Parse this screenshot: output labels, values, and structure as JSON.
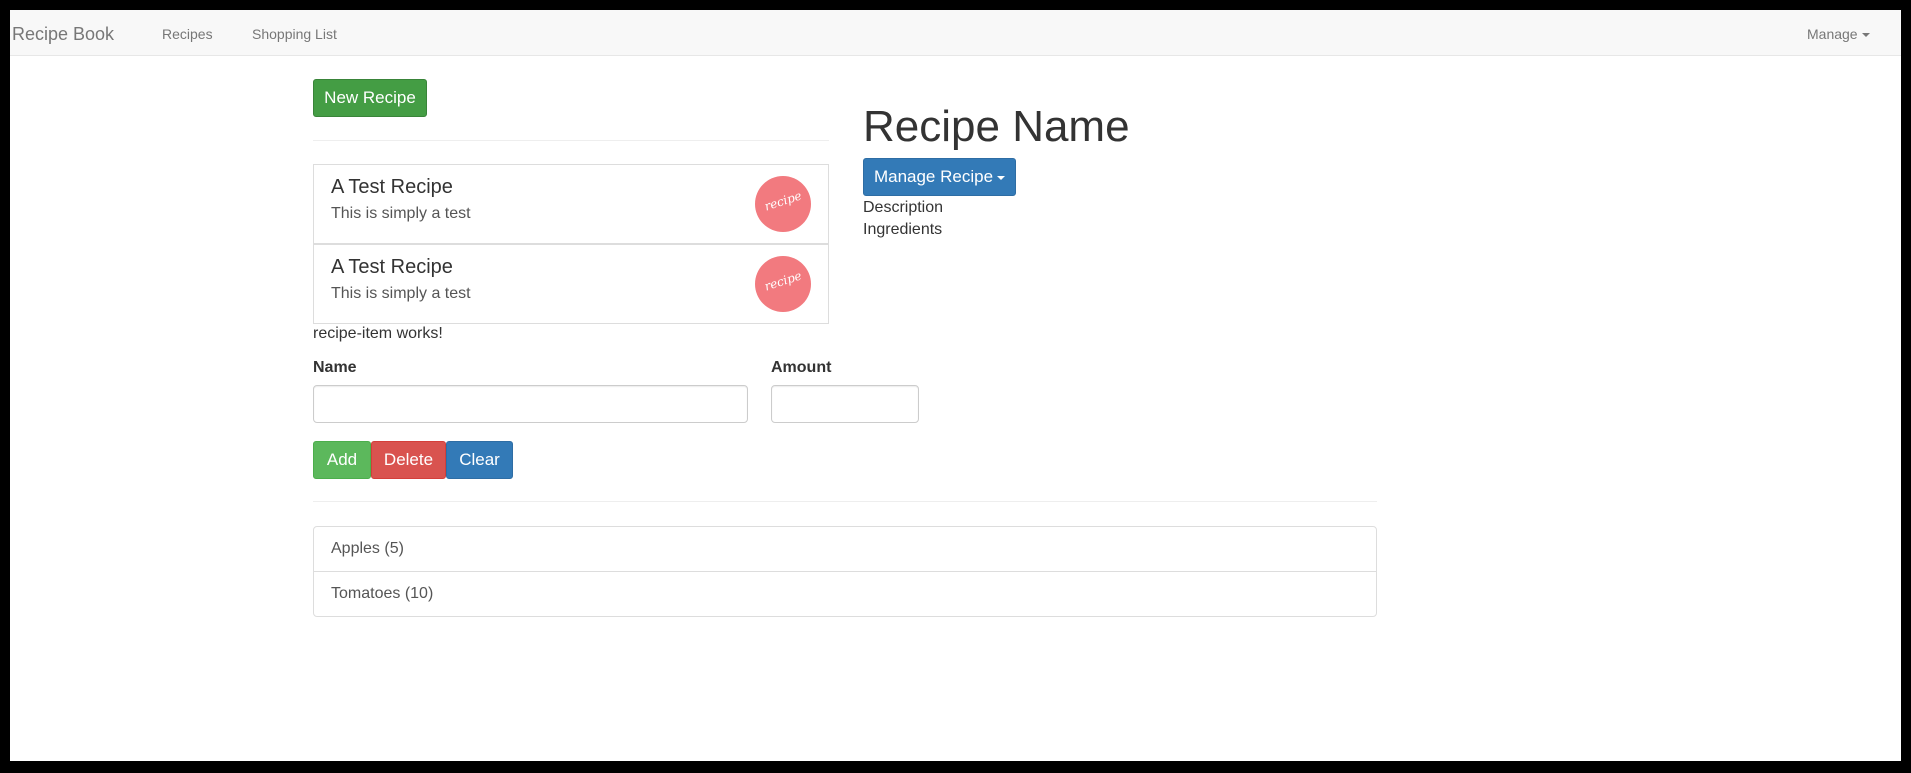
{
  "navbar": {
    "brand": "Recipe Book",
    "links": [
      "Recipes",
      "Shopping List"
    ],
    "manage": "Manage"
  },
  "recipes": {
    "new_button": "New Recipe",
    "items": [
      {
        "name": "A Test Recipe",
        "description": "This is simply a test",
        "image_text": "recipe"
      },
      {
        "name": "A Test Recipe",
        "description": "This is simply a test",
        "image_text": "recipe"
      }
    ],
    "item_works_text": "recipe-item works!"
  },
  "detail": {
    "title": "Recipe Name",
    "manage_button": "Manage Recipe",
    "description_label": "Description",
    "ingredients_label": "Ingredients"
  },
  "shopping_edit": {
    "name_label": "Name",
    "amount_label": "Amount",
    "name_value": "",
    "amount_value": "",
    "add_button": "Add",
    "delete_button": "Delete",
    "clear_button": "Clear"
  },
  "shopping_list": {
    "items": [
      "Apples (5)",
      "Tomatoes (10)"
    ]
  },
  "colors": {
    "success": "#5cb85c",
    "danger": "#d9534f",
    "primary": "#337ab7",
    "recipe_image": "#f27a7f"
  }
}
